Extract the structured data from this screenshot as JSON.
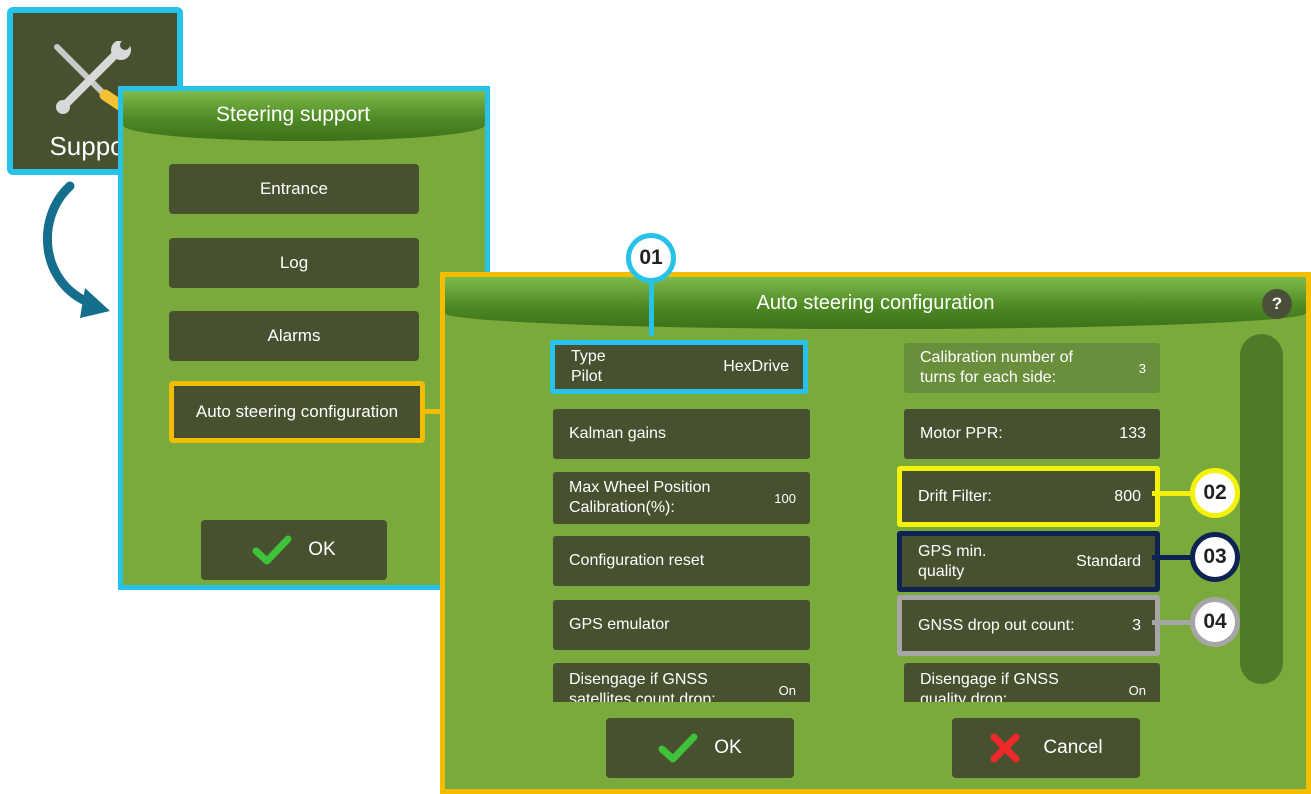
{
  "support_tile": {
    "label": "Support"
  },
  "steering_support": {
    "title": "Steering support",
    "buttons": [
      "Entrance",
      "Log",
      "Alarms",
      "Auto steering configuration"
    ],
    "ok_label": "OK"
  },
  "auto_config": {
    "title": "Auto steering configuration",
    "help": "?",
    "left_rows": [
      {
        "label": "Type\nPilot",
        "value": "HexDrive"
      },
      {
        "label": "Kalman gains",
        "value": ""
      },
      {
        "label": "Max Wheel Position\nCalibration(%):",
        "value": "100"
      },
      {
        "label": "Configuration reset",
        "value": ""
      },
      {
        "label": "GPS emulator",
        "value": ""
      },
      {
        "label": "Disengage if GNSS\nsatellites count drop:",
        "value": "On"
      }
    ],
    "right_rows": [
      {
        "label": "Calibration number of\nturns for each side:",
        "value": "3"
      },
      {
        "label": "Motor PPR:",
        "value": "133"
      },
      {
        "label": "Drift Filter:",
        "value": "800"
      },
      {
        "label": "GPS min.\nquality",
        "value": "Standard"
      },
      {
        "label": "GNSS drop out count:",
        "value": "3"
      },
      {
        "label": "Disengage if GNSS\nquality drop:",
        "value": "On"
      }
    ],
    "ok_label": "OK",
    "cancel_label": "Cancel"
  },
  "callouts": [
    "01",
    "02",
    "03",
    "04"
  ],
  "colors": {
    "panel_green": "#7aa93c",
    "button_dark": "#48512f",
    "highlight_cyan": "#27c2e9",
    "highlight_orange": "#f5bd00",
    "highlight_yellow": "#f4f20a",
    "highlight_navy": "#0f2352",
    "highlight_gray": "#a6a6a6"
  }
}
